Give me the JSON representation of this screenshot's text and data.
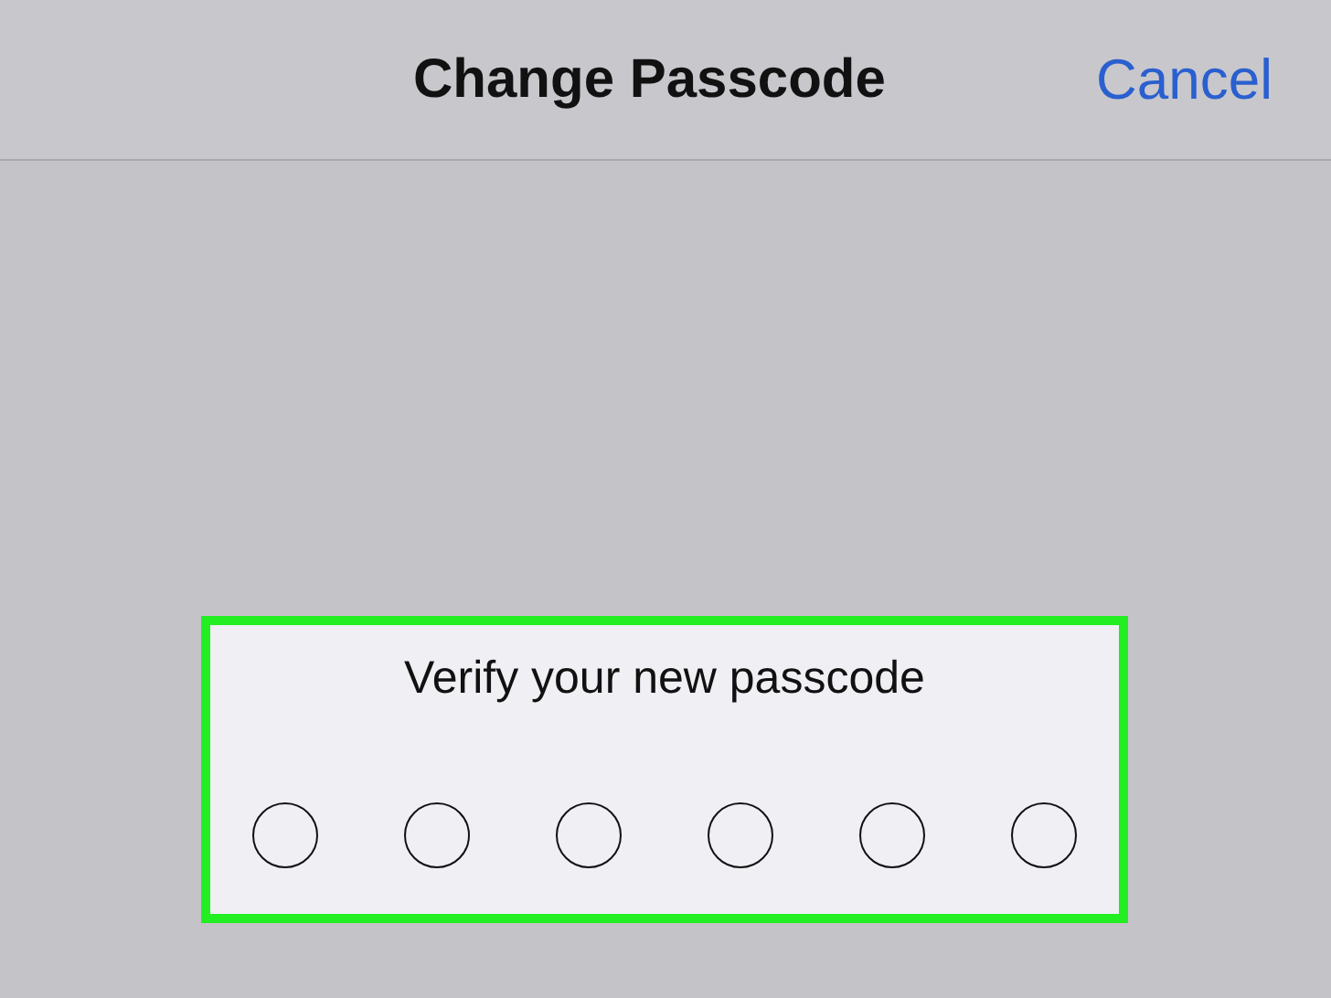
{
  "nav_bar": {
    "title": "Change Passcode",
    "cancel": "Cancel"
  },
  "passcode_panel": {
    "highlighted": true,
    "prompt": "Verify your new passcode",
    "dots": [
      {
        "filled": false
      },
      {
        "filled": false
      },
      {
        "filled": false
      },
      {
        "filled": false
      },
      {
        "filled": false
      },
      {
        "filled": false
      }
    ]
  }
}
